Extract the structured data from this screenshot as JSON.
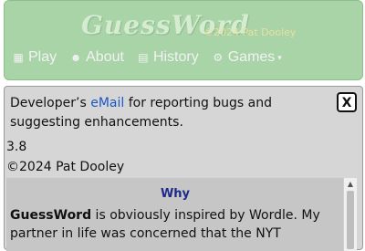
{
  "header": {
    "logo_text": "GuessWord",
    "copyright": "©2024 Pat Dooley",
    "nav": [
      {
        "label": "Play",
        "icon": "play-icon",
        "glyph": "▦"
      },
      {
        "label": "About",
        "icon": "about-icon",
        "glyph": "☻"
      },
      {
        "label": "History",
        "icon": "history-icon",
        "glyph": "▤"
      },
      {
        "label": "Games",
        "icon": "games-icon",
        "glyph": "⚙",
        "caret": "▾"
      }
    ],
    "colors": {
      "background": "#a8d4a8",
      "nav_text": "#f2f2f2",
      "logo": "#d6ecd0"
    }
  },
  "panel": {
    "dev_prefix": "Developer’s ",
    "dev_link": "eMail",
    "dev_suffix": " for reporting bugs and suggesting enhancements.",
    "close_label": "X",
    "version": "3.8",
    "copyright": "©2024 Pat Dooley",
    "about": {
      "heading": "Why",
      "para_bold": "GuessWord",
      "para_rest": " is obviously inspired by Wordle. My partner in life was concerned that the NYT"
    }
  }
}
